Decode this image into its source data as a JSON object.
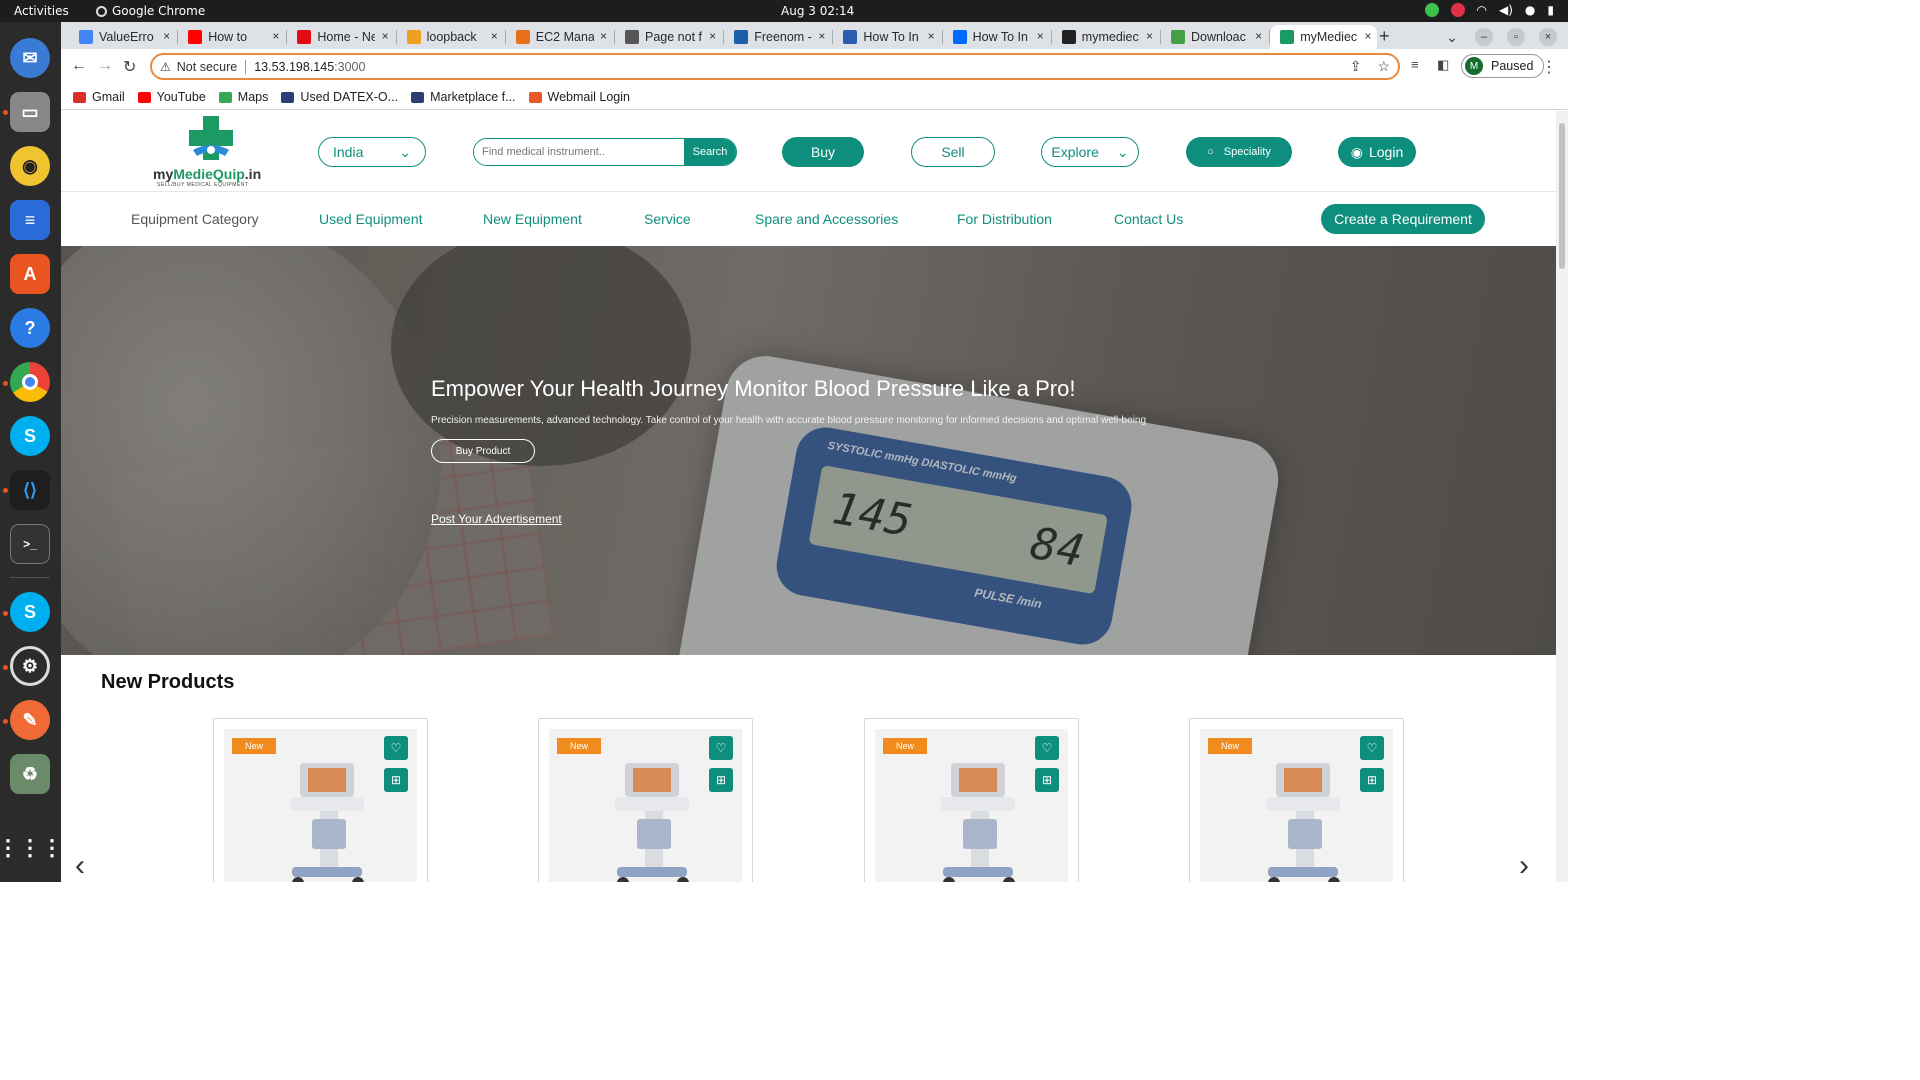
{
  "os": {
    "activities": "Activities",
    "app_name": "Google Chrome",
    "clock": "Aug 3  02:14"
  },
  "browser": {
    "tabs": [
      {
        "label": "ValueErro",
        "icon": "google-icon",
        "color": "#4285f4"
      },
      {
        "label": "How to",
        "icon": "youtube-icon",
        "color": "#ff0000"
      },
      {
        "label": "Home - Ne",
        "icon": "netflix-icon",
        "color": "#e50914"
      },
      {
        "label": "loopback",
        "icon": "loopback-icon",
        "color": "#f0a020"
      },
      {
        "label": "EC2 Mana",
        "icon": "aws-icon",
        "color": "#e7711b"
      },
      {
        "label": "Page not f",
        "icon": "globe-icon",
        "color": "#555555"
      },
      {
        "label": "Freenom -",
        "icon": "freenom-icon",
        "color": "#1b5fab"
      },
      {
        "label": "How To In",
        "icon": "blog-icon",
        "color": "#2a5db0"
      },
      {
        "label": "How To In",
        "icon": "digitalocean-icon",
        "color": "#0069ff"
      },
      {
        "label": "mymediec",
        "icon": "github-icon",
        "color": "#222222"
      },
      {
        "label": "Downloac",
        "icon": "node-icon",
        "color": "#43a047"
      },
      {
        "label": "myMediec",
        "icon": "site-icon",
        "color": "#1c9a64"
      }
    ],
    "address": {
      "security": "Not secure",
      "host": "13.53.198.145",
      "port": ":3000"
    },
    "profile": {
      "initial": "M",
      "status": "Paused"
    },
    "bookmarks": [
      {
        "label": "Gmail",
        "color": "#d93025"
      },
      {
        "label": "YouTube",
        "color": "#ff0000"
      },
      {
        "label": "Maps",
        "color": "#34a853"
      },
      {
        "label": "Used DATEX-O...",
        "color": "#2c3e73"
      },
      {
        "label": "Marketplace f...",
        "color": "#2c3e73"
      },
      {
        "label": "Webmail Login",
        "color": "#e8572a"
      }
    ]
  },
  "site": {
    "logo": {
      "brand_prefix": "my",
      "brand_main": "MedieQuip",
      "brand_suffix": ".in",
      "tagline": "SELL/BUY MEDICAL EQUIPMENT"
    },
    "country": "India",
    "search": {
      "placeholder": "Find medical instrument..",
      "button": "Search"
    },
    "buttons": {
      "buy": "Buy",
      "sell": "Sell",
      "explore": "Explore",
      "speciality": "Speciality",
      "login": "Login"
    },
    "nav": {
      "equipment_category": "Equipment Category",
      "used": "Used Equipment",
      "new": "New Equipment",
      "service": "Service",
      "spare": "Spare and Accessories",
      "distribution": "For Distribution",
      "contact": "Contact Us",
      "create": "Create a Requirement"
    },
    "hero": {
      "title": "Empower Your Health Journey Monitor Blood Pressure Like a Pro!",
      "subtitle": "Precision measurements, advanced technology. Take control of your health with accurate blood pressure monitoring for informed decisions and optimal well-being",
      "cta": "Buy Product",
      "post": "Post Your Advertisement",
      "lcd_sys": "145",
      "lcd_dia": "84",
      "lcd_label_top": "SYSTOLIC mmHg   DIASTOLIC mmHg",
      "lcd_label_bot": "PULSE /min"
    },
    "products": {
      "title": "New Products",
      "items": [
        {
          "badge": "New"
        },
        {
          "badge": "New"
        },
        {
          "badge": "New"
        },
        {
          "badge": "New"
        }
      ]
    }
  }
}
